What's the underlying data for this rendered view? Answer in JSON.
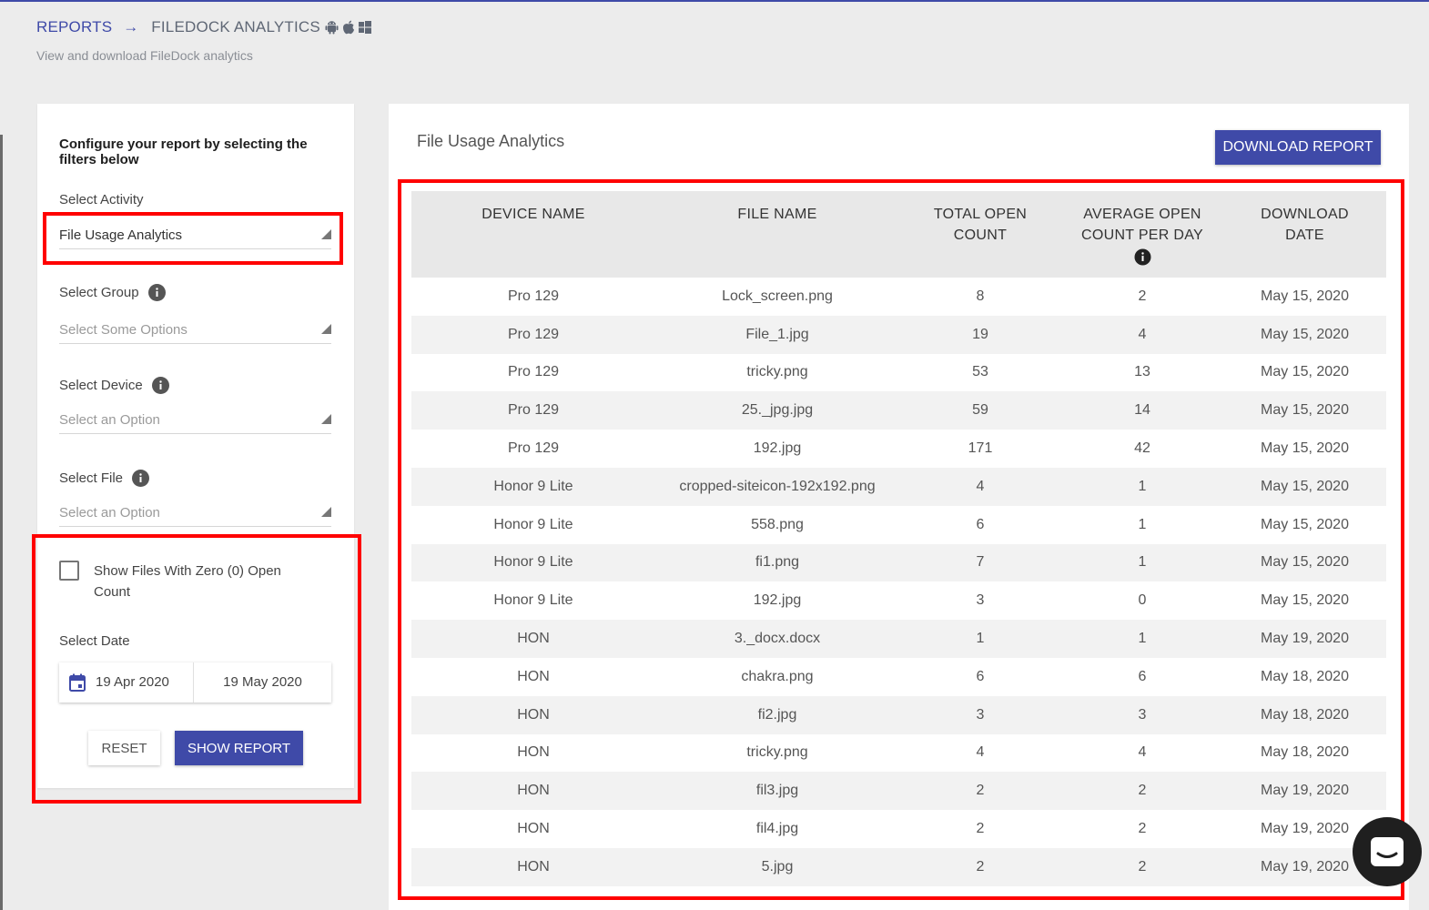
{
  "breadcrumb": {
    "reports_label": "REPORTS",
    "arrow": "→",
    "current_label": "FILEDOCK ANALYTICS",
    "os_icons": [
      "android-icon",
      "apple-icon",
      "windows-icon"
    ]
  },
  "subtitle": "View and download FileDock analytics",
  "filters": {
    "intro": "Configure your report by selecting the filters below",
    "activity": {
      "label": "Select Activity",
      "value": "File Usage Analytics"
    },
    "group": {
      "label": "Select Group",
      "placeholder": "Select Some Options"
    },
    "device": {
      "label": "Select Device",
      "placeholder": "Select an Option"
    },
    "file": {
      "label": "Select File",
      "placeholder": "Select an Option"
    },
    "zero_open_checkbox": {
      "label": "Show Files With Zero (0) Open Count",
      "checked": false
    },
    "date": {
      "label": "Select Date",
      "from": "19 Apr 2020",
      "to": "19 May 2020"
    },
    "reset_label": "RESET",
    "show_report_label": "SHOW REPORT"
  },
  "report": {
    "title": "File Usage Analytics",
    "download_label": "DOWNLOAD REPORT",
    "columns": [
      "DEVICE NAME",
      "FILE NAME",
      "TOTAL OPEN COUNT",
      "AVERAGE OPEN COUNT PER DAY",
      "DOWNLOAD DATE"
    ],
    "rows": [
      [
        "Pro 129",
        "Lock_screen.png",
        "8",
        "2",
        "May 15, 2020"
      ],
      [
        "Pro 129",
        "File_1.jpg",
        "19",
        "4",
        "May 15, 2020"
      ],
      [
        "Pro 129",
        "tricky.png",
        "53",
        "13",
        "May 15, 2020"
      ],
      [
        "Pro 129",
        "25._jpg.jpg",
        "59",
        "14",
        "May 15, 2020"
      ],
      [
        "Pro 129",
        "192.jpg",
        "171",
        "42",
        "May 15, 2020"
      ],
      [
        "Honor 9 Lite",
        "cropped-siteicon-192x192.png",
        "4",
        "1",
        "May 15, 2020"
      ],
      [
        "Honor 9 Lite",
        "558.png",
        "6",
        "1",
        "May 15, 2020"
      ],
      [
        "Honor 9 Lite",
        "fi1.png",
        "7",
        "1",
        "May 15, 2020"
      ],
      [
        "Honor 9 Lite",
        "192.jpg",
        "3",
        "0",
        "May 15, 2020"
      ],
      [
        "HON",
        "3._docx.docx",
        "1",
        "1",
        "May 19, 2020"
      ],
      [
        "HON",
        "chakra.png",
        "6",
        "6",
        "May 18, 2020"
      ],
      [
        "HON",
        "fi2.jpg",
        "3",
        "3",
        "May 18, 2020"
      ],
      [
        "HON",
        "tricky.png",
        "4",
        "4",
        "May 18, 2020"
      ],
      [
        "HON",
        "fil3.jpg",
        "2",
        "2",
        "May 19, 2020"
      ],
      [
        "HON",
        "fil4.jpg",
        "2",
        "2",
        "May 19, 2020"
      ],
      [
        "HON",
        "5.jpg",
        "2",
        "2",
        "May 19, 2020"
      ]
    ]
  },
  "colors": {
    "accent": "#3f4aa8",
    "highlight": "#ff0000",
    "background": "#ececec"
  }
}
